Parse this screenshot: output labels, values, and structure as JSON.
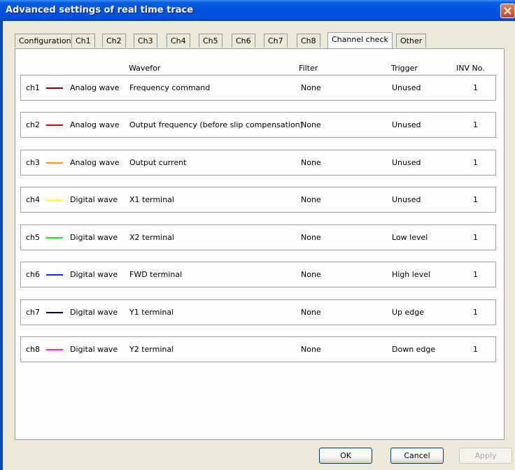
{
  "window": {
    "title": "Advanced settings of real time trace"
  },
  "tabs": [
    "Configuration",
    "Ch1",
    "Ch2",
    "Ch3",
    "Ch4",
    "Ch5",
    "Ch6",
    "Ch7",
    "Ch8",
    "Channel check",
    "Other"
  ],
  "active_tab": "Channel check",
  "headers": {
    "waveform": "Wavefor",
    "filter": "Filter",
    "trigger": "Trigger",
    "inv": "INV No."
  },
  "channels": [
    {
      "ch": "ch1",
      "color": "#800000",
      "type": "Analog wave",
      "signal": "Frequency command",
      "filter": "None",
      "trigger": "Unused",
      "inv": "1"
    },
    {
      "ch": "ch2",
      "color": "#d40000",
      "type": "Analog wave",
      "signal": "Output frequency (before slip compensation)",
      "filter": "None",
      "trigger": "Unused",
      "inv": "1"
    },
    {
      "ch": "ch3",
      "color": "#f7941d",
      "type": "Analog wave",
      "signal": "Output current",
      "filter": "None",
      "trigger": "Unused",
      "inv": "1"
    },
    {
      "ch": "ch4",
      "color": "#ffff33",
      "type": "Digital wave",
      "signal": "X1 terminal",
      "filter": "None",
      "trigger": "Unused",
      "inv": "1"
    },
    {
      "ch": "ch5",
      "color": "#22dd22",
      "type": "Digital wave",
      "signal": "X2 terminal",
      "filter": "None",
      "trigger": "Low level",
      "inv": "1"
    },
    {
      "ch": "ch6",
      "color": "#1428d8",
      "type": "Digital wave",
      "signal": "FWD terminal",
      "filter": "None",
      "trigger": "High level",
      "inv": "1"
    },
    {
      "ch": "ch7",
      "color": "#000044",
      "type": "Digital wave",
      "signal": "Y1 terminal",
      "filter": "None",
      "trigger": "Up edge",
      "inv": "1"
    },
    {
      "ch": "ch8",
      "color": "#ee22ee",
      "type": "Digital wave",
      "signal": "Y2 terminal",
      "filter": "None",
      "trigger": "Down edge",
      "inv": "1"
    }
  ],
  "buttons": {
    "ok": "OK",
    "cancel": "Cancel",
    "apply": "Apply"
  },
  "icons": {
    "close": "close-icon"
  }
}
